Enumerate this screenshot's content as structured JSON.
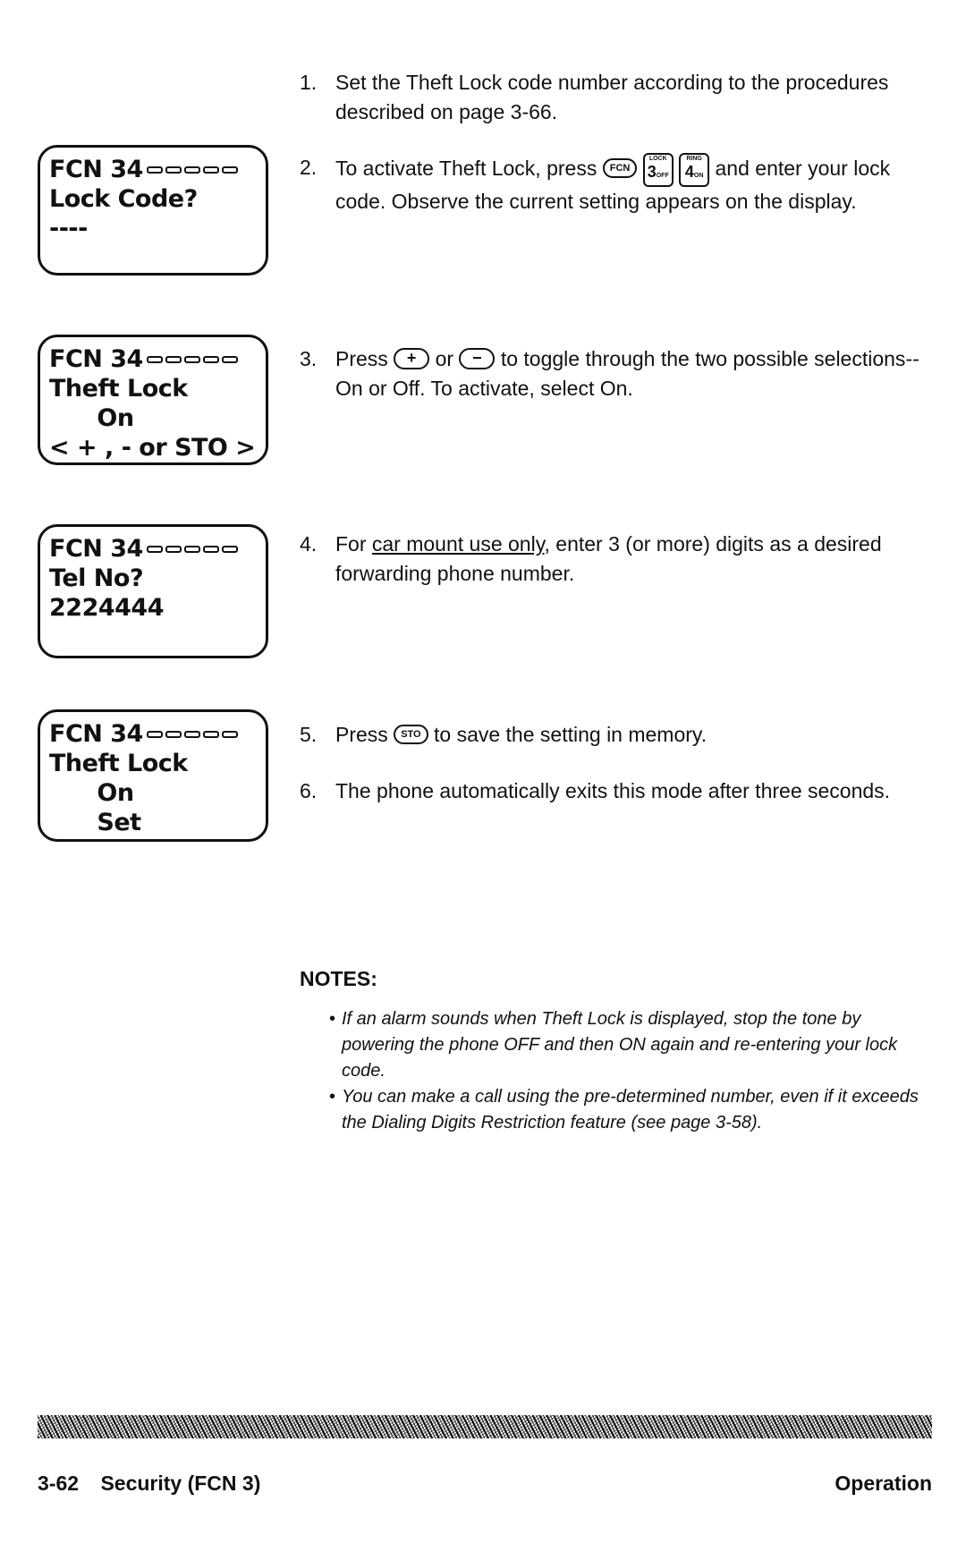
{
  "displays": [
    {
      "lines": [
        "FCN 34",
        "Lock Code?",
        "----",
        ""
      ]
    },
    {
      "lines": [
        "FCN 34",
        "Theft Lock",
        "      On",
        "< + , - or STO >"
      ]
    },
    {
      "lines": [
        "FCN 34",
        "Tel No?",
        "2224444",
        ""
      ]
    },
    {
      "lines": [
        "FCN 34",
        "Theft Lock",
        "      On",
        "      Set"
      ]
    }
  ],
  "steps": [
    {
      "num": "1.",
      "text": "Set the Theft Lock code number according to the procedures described on page 3-66."
    },
    {
      "num": "2.",
      "pre": "To activate Theft Lock, press",
      "keys": {
        "fcn": "FCN",
        "k3_top": "LOCK",
        "k3": "3",
        "k3_sub": "OFF",
        "k4_top": "RING",
        "k4": "4",
        "k4_sub": "ON"
      },
      "post": "and enter your lock code.  Observe the current setting appears on the display."
    },
    {
      "num": "3.",
      "pre": "Press",
      "plus": "+",
      "or": "or",
      "minus": "−",
      "post": "to toggle through the two possible selections--On or Off.  To activate, select On."
    },
    {
      "num": "4.",
      "pre": "For",
      "underlined": "car mount use only",
      "post": ", enter 3 (or more) digits as a desired forwarding phone number."
    },
    {
      "num": "5.",
      "pre": "Press",
      "key": "STO",
      "post": "to save the setting in memory."
    },
    {
      "num": "6.",
      "text": "The phone automatically exits this mode after three seconds."
    }
  ],
  "notes": {
    "heading": "NOTES:",
    "items": [
      "If an alarm sounds when Theft Lock is displayed, stop the tone by powering the phone OFF and then ON again and re-entering your lock code.",
      "You can make a call using the pre-determined number, even if it exceeds the Dialing Digits Restriction feature (see page 3-58)."
    ]
  },
  "footer": {
    "page": "3-62",
    "section": "Security (FCN 3)",
    "chapter": "Operation"
  }
}
